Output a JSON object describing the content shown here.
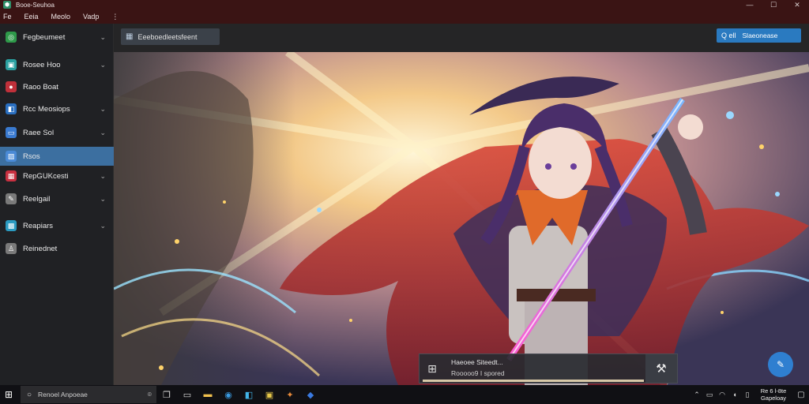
{
  "window": {
    "title": "Booe-Seuhoa",
    "controls": {
      "minimize": "—",
      "maximize": "☐",
      "close": "✕"
    }
  },
  "menu": [
    "Fe",
    "Eeia",
    "Meolo",
    "Vadp",
    "⋮"
  ],
  "sidebar": {
    "items": [
      {
        "label": "Fegbeumeet",
        "icon": "target-icon",
        "color": "#2e9a4a",
        "chevron": true,
        "active": false
      },
      {
        "label": "Rosee Hoo",
        "icon": "image-icon",
        "color": "#2aa0a0",
        "chevron": true,
        "active": false
      },
      {
        "label": "Raoo Boat",
        "icon": "record-icon",
        "color": "#c0303a",
        "chevron": false,
        "active": false
      },
      {
        "label": "Rcc Meosiops",
        "icon": "layers-icon",
        "color": "#2a6fc0",
        "chevron": true,
        "active": false
      },
      {
        "label": "Raee Sol",
        "icon": "folder-icon",
        "color": "#3a7ad0",
        "chevron": true,
        "active": false
      },
      {
        "label": "Rsos",
        "icon": "photo-icon",
        "color": "#4a8ad6",
        "chevron": false,
        "active": true
      },
      {
        "label": "RepGUKcesti",
        "icon": "grid-icon",
        "color": "#c83040",
        "chevron": true,
        "active": false
      },
      {
        "label": "Reelgail",
        "icon": "pen-icon",
        "color": "#7a7a7a",
        "chevron": true,
        "active": false
      },
      {
        "label": "Reapiars",
        "icon": "gallery-icon",
        "color": "#2a9ac0",
        "chevron": true,
        "active": false
      },
      {
        "label": "Reinednet",
        "icon": "user-icon",
        "color": "#7a7a7a",
        "chevron": false,
        "active": false
      }
    ]
  },
  "toolbar": {
    "left_label": "Eeeboedleetsfeent",
    "right_label": "Slaeonease",
    "right_prefix": "Q ell"
  },
  "overlay": {
    "title": "Haeoee Siteedt...",
    "subtitle": "Rooooo9 I spored"
  },
  "taskbar": {
    "search_placeholder": "Renoel Anpoeae",
    "time": "Re 6 l-8te",
    "date": "Gapeloay"
  },
  "colors": {
    "accent": "#2a7ac0",
    "active_item": "#3c6fa0",
    "titlebar": "#3a1414"
  }
}
